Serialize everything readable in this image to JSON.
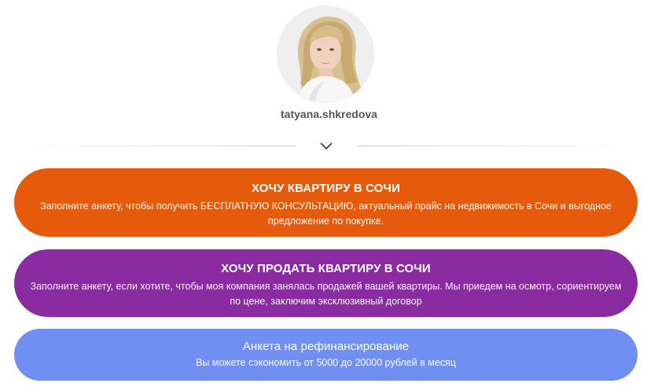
{
  "profile": {
    "username": "tatyana.shkredova",
    "avatar_icon": "profile-photo"
  },
  "divider": {
    "toggle_icon": "chevron-down-icon"
  },
  "cards": [
    {
      "title": "ХОЧУ КВАРТИРУ В СОЧИ",
      "description": "Заполните анкету, чтобы получить БЕСПЛАТНУЮ КОНСУЛЬТАЦИЮ, актуальный прайс на недвижимость в Сочи и выгодное предложение по покупке.",
      "color": "#e65a0b"
    },
    {
      "title": "ХОЧУ ПРОДАТЬ КВАРТИРУ В СОЧИ",
      "description": "Заполните анкету, если хотите, чтобы моя компания занялась продажей вашей квартиры. Мы приедем на осмотр, сориентируем по цене, заключим эксклюзивный договор",
      "color": "#8a2ba1"
    },
    {
      "title": "Анкета на рефинансирование",
      "description": "Вы можете сэкономить от 5000 до 20000 рублей в месяц",
      "color": "#6f8ff2"
    }
  ]
}
